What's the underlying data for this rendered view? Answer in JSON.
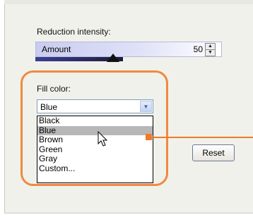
{
  "reduction": {
    "label": "Reduction intensity:",
    "slider_label": "Amount",
    "value": "50",
    "slider_fraction": 0.5
  },
  "fill": {
    "label": "Fill color:",
    "selected": "Blue",
    "options": [
      "Black",
      "Blue",
      "Brown",
      "Green",
      "Gray",
      "Custom..."
    ],
    "highlighted_index": 1
  },
  "buttons": {
    "reset": "Reset"
  },
  "colors": {
    "callout": "#ee8a42",
    "slider_fill": "#2b2f73"
  }
}
